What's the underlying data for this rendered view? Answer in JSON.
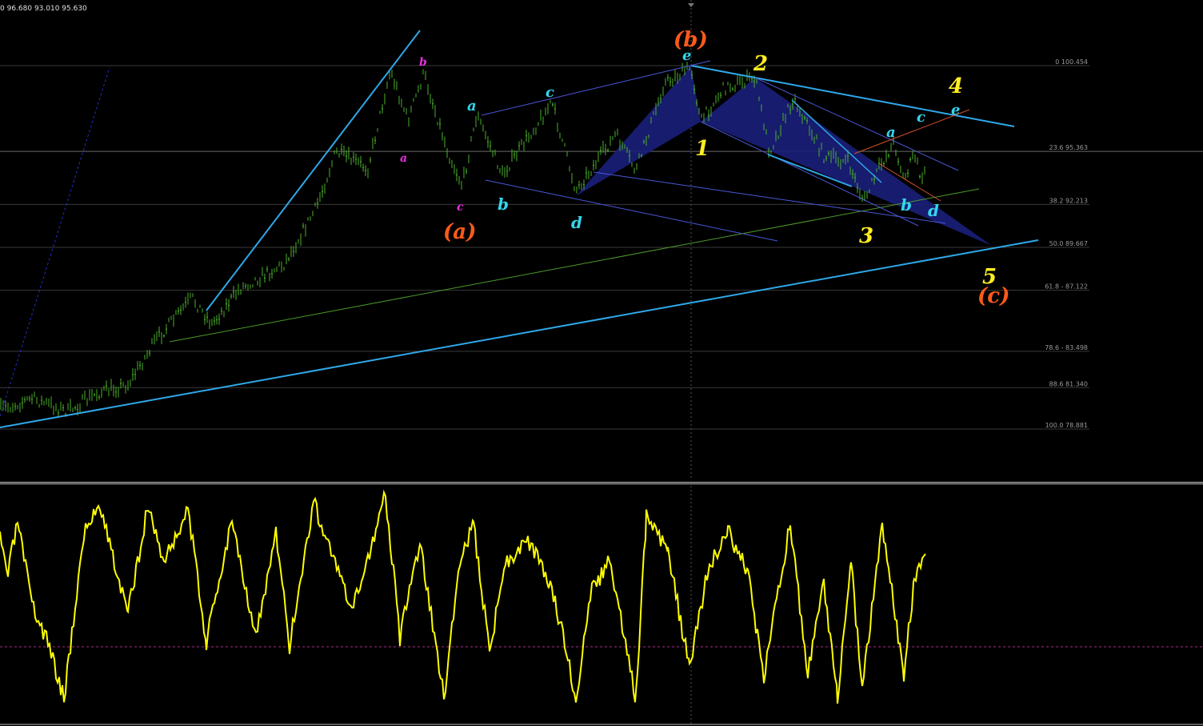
{
  "header": {
    "ohlc_text": "0 96.680 93.010 95.630"
  },
  "colors": {
    "background": "#000000",
    "candle": "#4caf2a",
    "fib_line": "#3a3a3a",
    "trend_cyan": "#2fa8e8",
    "channel_blue": "#4a57d8",
    "triangle_fill": "#1a1f7a",
    "support_green": "#4c9a2a",
    "resistance_red": "#d0502a",
    "oscillator": "#ffff00",
    "zero_line": "#b02a8a",
    "wave_orange": "#ff5a1a",
    "wave_yellow": "#ffee22",
    "wave_cyan": "#33d6ee",
    "wave_magenta": "#e62ee0"
  },
  "fib_levels": [
    {
      "level": "0",
      "price": "100.454",
      "label": "0 100.454"
    },
    {
      "level": "23.6",
      "price": "95.363",
      "label": "23.6 95.363"
    },
    {
      "level": "38.2",
      "price": "92.213",
      "label": "38.2 92.213"
    },
    {
      "level": "50.0",
      "price": "89.667",
      "label": "50.0 89.667"
    },
    {
      "level": "61.8",
      "price": "87.122",
      "label": "61.8 - 87.122"
    },
    {
      "level": "78.6",
      "price": "83.498",
      "label": "78.6 - 83.498"
    },
    {
      "level": "88.6",
      "price": "81.340",
      "label": "88.6 81.340"
    },
    {
      "level": "100.0",
      "price": "78.881",
      "label": "100.0 78.881"
    }
  ],
  "wave_labels": {
    "b_paren": "(b)",
    "a_paren": "(a)",
    "c_paren": "(c)",
    "w1": "1",
    "w2": "2",
    "w3": "3",
    "w4": "4",
    "w5": "5",
    "small_b_magenta": "b",
    "small_a_magenta": "a",
    "small_c_magenta": "c",
    "cyan_a_left": "a",
    "cyan_c_left": "c",
    "cyan_b_left": "b",
    "cyan_d_left": "d",
    "cyan_e_top": "e",
    "cyan_a_right": "a",
    "cyan_c_right": "c",
    "cyan_b_right": "b",
    "cyan_d_right": "d",
    "cyan_e_right": "e"
  }
}
